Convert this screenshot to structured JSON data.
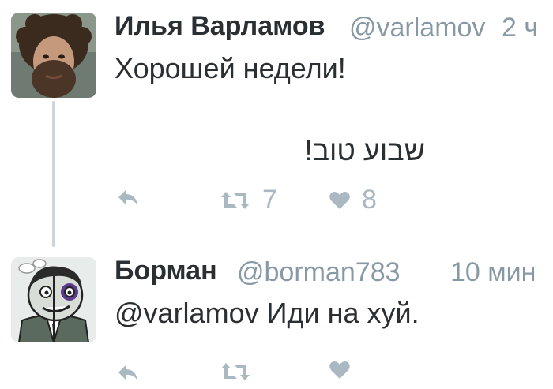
{
  "tweets": [
    {
      "name": "Илья Варламов",
      "handle": "@varlamov",
      "time": "2 ч",
      "text": "Хорошей недели!",
      "text_rtl": "שבוע טוב!",
      "retweets": "7",
      "likes": "8",
      "avatar": "bearded-man-avatar"
    },
    {
      "name": "Борман",
      "handle": "@borman783",
      "time": "10 мин",
      "text": "@varlamov Иди на хуй.",
      "retweets": "",
      "likes": "",
      "avatar": "cartoon-man-avatar"
    }
  ],
  "colors": {
    "name": "#292f33",
    "meta": "#8899a6",
    "icon": "#aab8c2",
    "thread_line": "#ccd6dd"
  },
  "icons": [
    "reply-icon",
    "retweet-icon",
    "like-icon"
  ]
}
